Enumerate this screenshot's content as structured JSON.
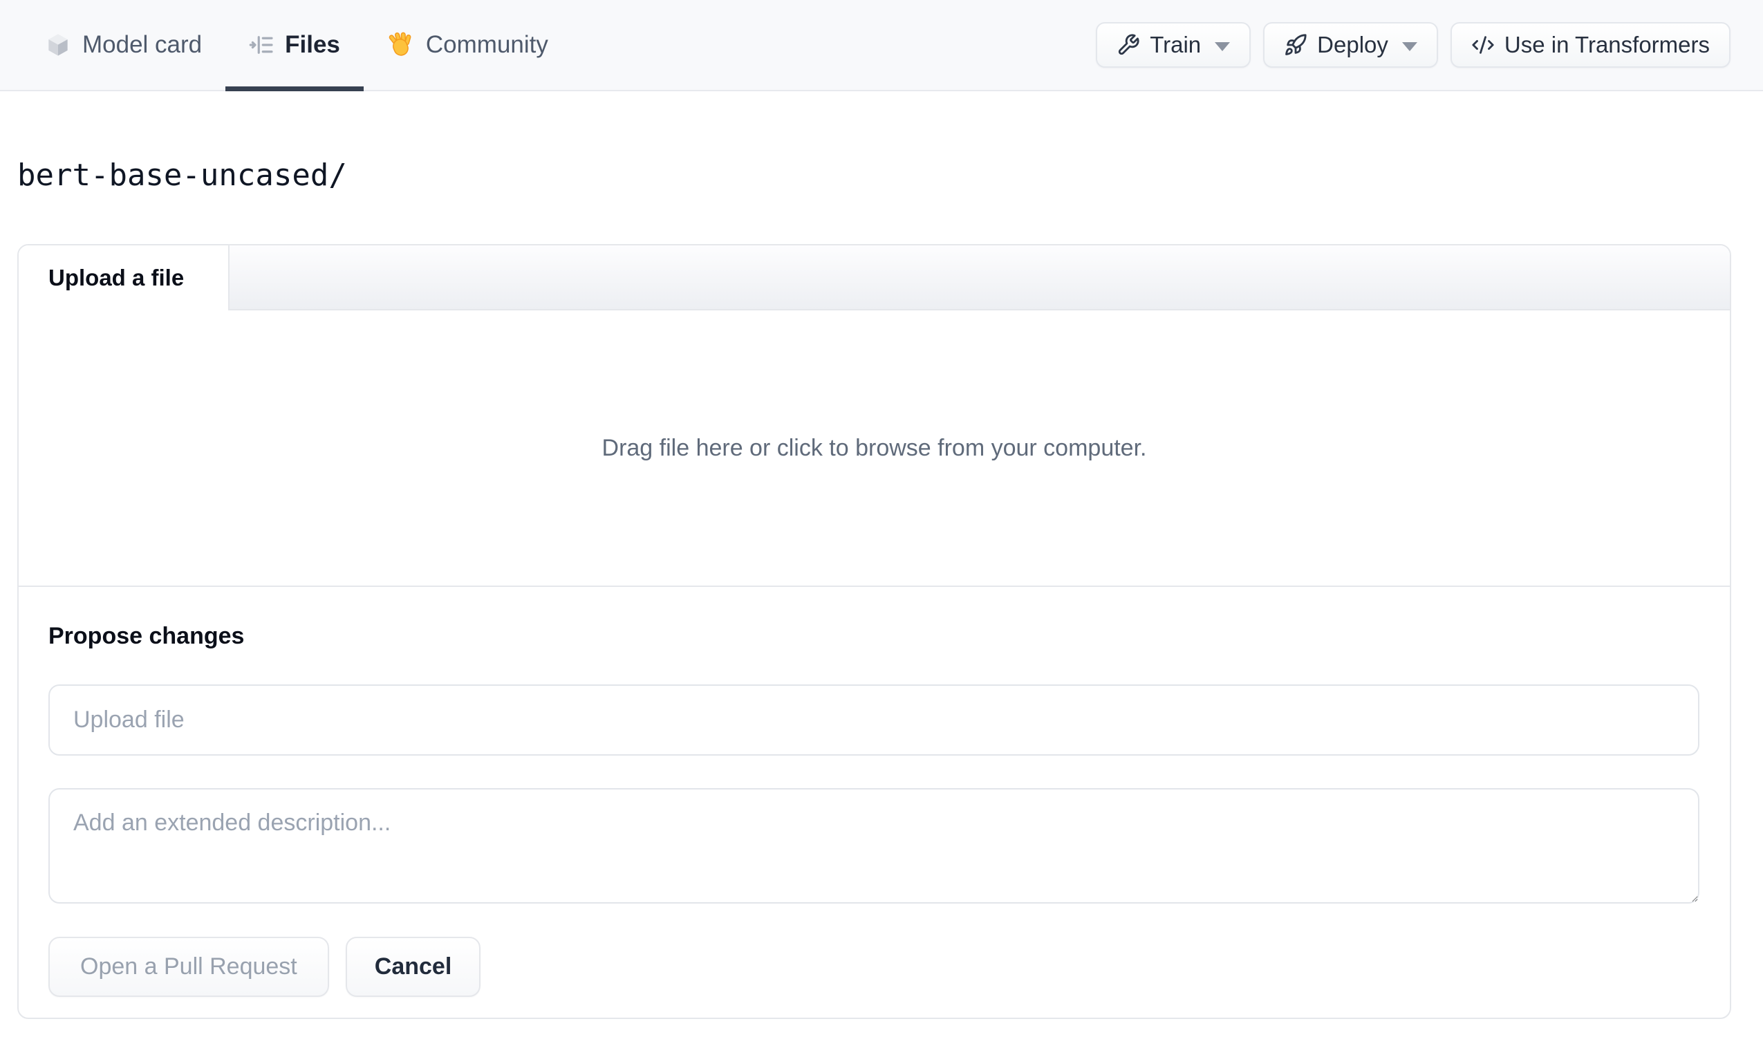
{
  "nav": {
    "tabs": [
      {
        "label": "Model card",
        "icon": "cube-icon"
      },
      {
        "label": "Files",
        "icon": "files-list-icon"
      },
      {
        "label": "Community",
        "icon": "waving-hand-icon"
      }
    ],
    "active_tab": "Files",
    "actions": [
      {
        "label": "Train",
        "icon": "wrench-icon",
        "has_caret": true
      },
      {
        "label": "Deploy",
        "icon": "rocket-icon",
        "has_caret": true
      },
      {
        "label": "Use in Transformers",
        "icon": "code-icon",
        "has_caret": false
      }
    ]
  },
  "breadcrumb": {
    "repo_path": "bert-base-uncased/"
  },
  "upload_card": {
    "tab_label": "Upload a file",
    "dropzone_text": "Drag file here or click to browse from your computer.",
    "propose_heading": "Propose changes",
    "filename_placeholder": "Upload file",
    "description_placeholder": "Add an extended description...",
    "open_pr_label": "Open a Pull Request",
    "cancel_label": "Cancel"
  },
  "colors": {
    "navbar_bg": "#f8f9fb",
    "active_tab_underline": "#374151",
    "border": "#e5e7eb",
    "text_primary": "#111827",
    "text_secondary": "#4e596b",
    "placeholder": "#9aa3b1",
    "dropzone_text": "#5f6a7a",
    "disabled_button_text": "#98a1ae",
    "hand_emoji_yellow": "#fdc23c"
  }
}
